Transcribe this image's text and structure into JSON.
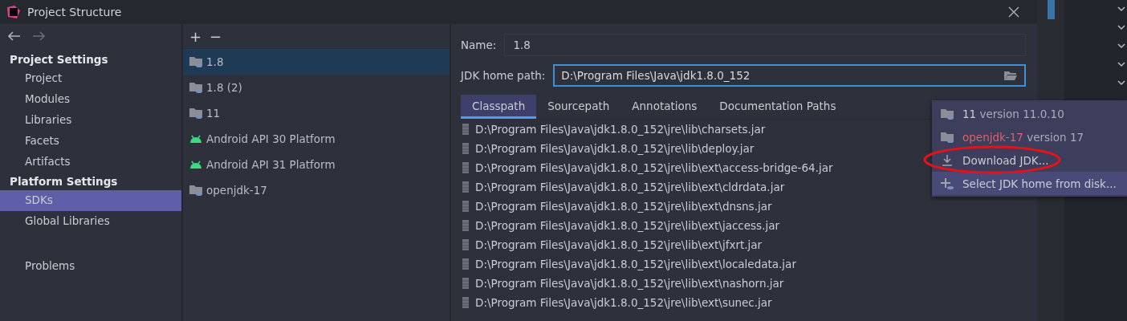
{
  "window": {
    "title": "Project Structure"
  },
  "sidebar": {
    "sections": [
      {
        "title": "Project Settings",
        "items": [
          {
            "label": "Project",
            "selected": false
          },
          {
            "label": "Modules",
            "selected": false
          },
          {
            "label": "Libraries",
            "selected": false
          },
          {
            "label": "Facets",
            "selected": false
          },
          {
            "label": "Artifacts",
            "selected": false
          }
        ]
      },
      {
        "title": "Platform Settings",
        "items": [
          {
            "label": "SDKs",
            "selected": true
          },
          {
            "label": "Global Libraries",
            "selected": false
          }
        ]
      }
    ],
    "extra_items": [
      {
        "label": "Problems",
        "selected": false
      }
    ]
  },
  "sdk_list": {
    "toolbar": [
      "+",
      "−"
    ],
    "items": [
      {
        "label": "1.8",
        "kind": "jdk",
        "selected": true
      },
      {
        "label": "1.8 (2)",
        "kind": "jdk",
        "selected": false
      },
      {
        "label": "11",
        "kind": "jdk",
        "selected": false
      },
      {
        "label": "Android API 30 Platform",
        "kind": "android",
        "selected": false
      },
      {
        "label": "Android API 31 Platform",
        "kind": "android",
        "selected": false
      },
      {
        "label": "openjdk-17",
        "kind": "jdk",
        "selected": false
      }
    ]
  },
  "details": {
    "name_label": "Name:",
    "name_value": "1.8",
    "path_label": "JDK home path:",
    "path_value": "D:\\Program Files\\Java\\jdk1.8.0_152",
    "tabs": [
      {
        "label": "Classpath",
        "selected": true
      },
      {
        "label": "Sourcepath",
        "selected": false
      },
      {
        "label": "Annotations",
        "selected": false
      },
      {
        "label": "Documentation Paths",
        "selected": false
      }
    ],
    "classpath": [
      "D:\\Program Files\\Java\\jdk1.8.0_152\\jre\\lib\\charsets.jar",
      "D:\\Program Files\\Java\\jdk1.8.0_152\\jre\\lib\\deploy.jar",
      "D:\\Program Files\\Java\\jdk1.8.0_152\\jre\\lib\\ext\\access-bridge-64.jar",
      "D:\\Program Files\\Java\\jdk1.8.0_152\\jre\\lib\\ext\\cldrdata.jar",
      "D:\\Program Files\\Java\\jdk1.8.0_152\\jre\\lib\\ext\\dnsns.jar",
      "D:\\Program Files\\Java\\jdk1.8.0_152\\jre\\lib\\ext\\jaccess.jar",
      "D:\\Program Files\\Java\\jdk1.8.0_152\\jre\\lib\\ext\\jfxrt.jar",
      "D:\\Program Files\\Java\\jdk1.8.0_152\\jre\\lib\\ext\\localedata.jar",
      "D:\\Program Files\\Java\\jdk1.8.0_152\\jre\\lib\\ext\\nashorn.jar",
      "D:\\Program Files\\Java\\jdk1.8.0_152\\jre\\lib\\ext\\sunec.jar"
    ]
  },
  "popup": {
    "items": [
      {
        "kind": "sdk",
        "name": "11",
        "version": "version 11.0.10",
        "error": false,
        "selected": false,
        "circled": false
      },
      {
        "kind": "sdk",
        "name": "openjdk-17",
        "version": "version 17",
        "error": true,
        "selected": false,
        "circled": false
      },
      {
        "kind": "download",
        "name": "Download JDK...",
        "selected": false,
        "circled": true
      },
      {
        "kind": "add",
        "name": "Select JDK home from disk...",
        "selected": true,
        "circled": false
      }
    ]
  }
}
